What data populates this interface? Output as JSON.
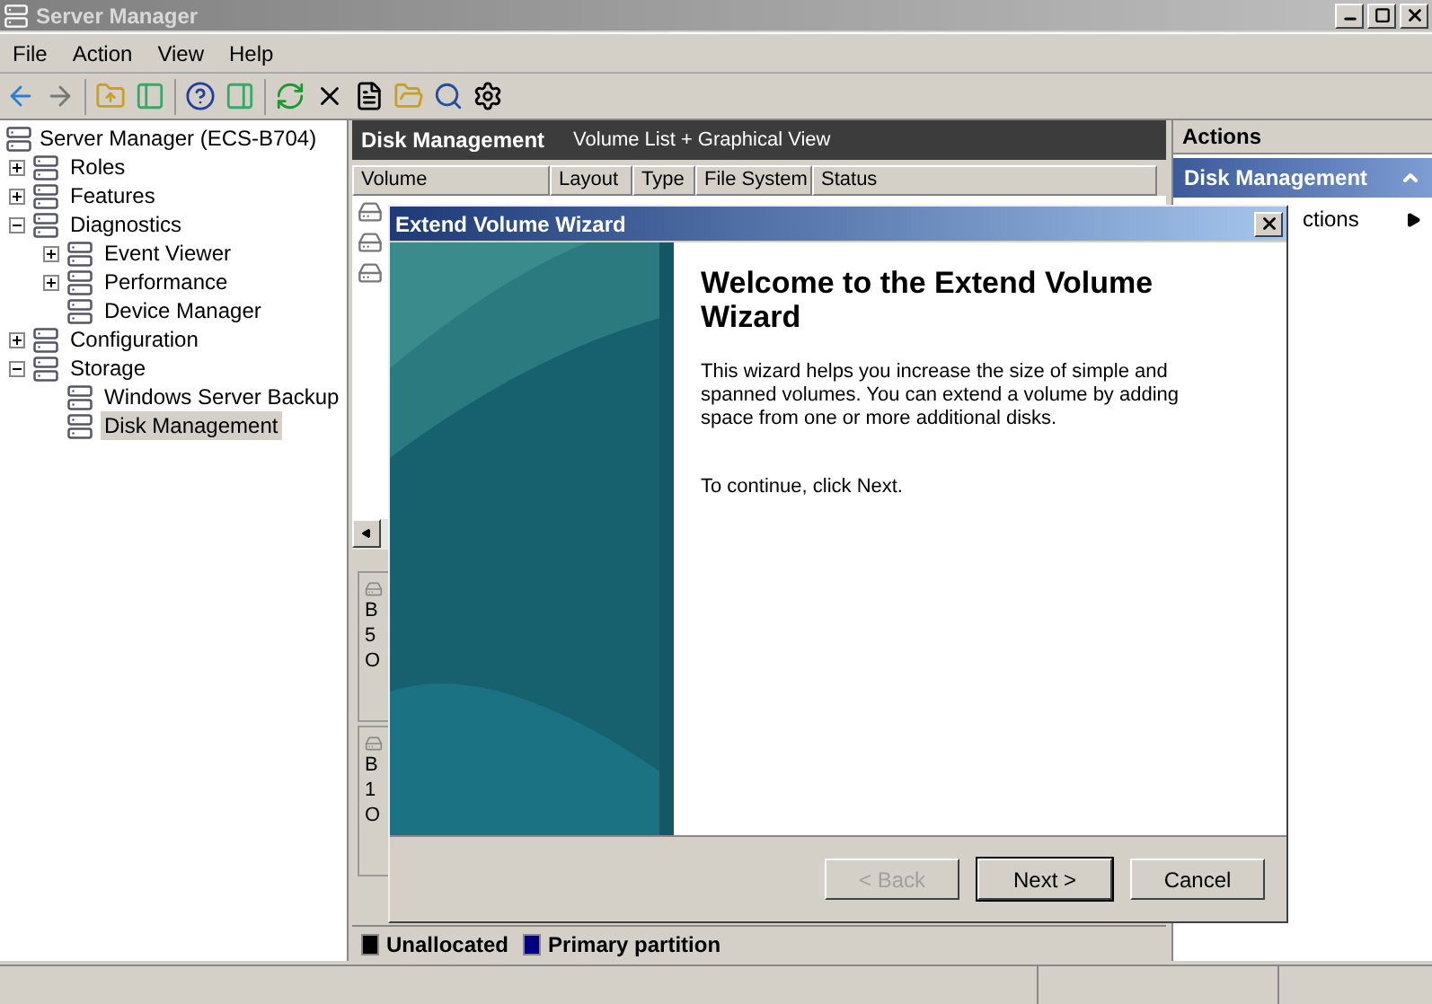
{
  "window": {
    "title": "Server Manager"
  },
  "menu": [
    "File",
    "Action",
    "View",
    "Help"
  ],
  "tree": {
    "label": "Server Manager (ECS-B704)",
    "selected": false,
    "children": [
      {
        "label": "Roles",
        "expanded": false,
        "selected": false
      },
      {
        "label": "Features",
        "expanded": false,
        "selected": false
      },
      {
        "label": "Diagnostics",
        "expanded": true,
        "selected": false,
        "children": [
          {
            "label": "Event Viewer",
            "expanded": false,
            "selected": false
          },
          {
            "label": "Performance",
            "expanded": false,
            "selected": false
          },
          {
            "label": "Device Manager",
            "selected": false
          }
        ]
      },
      {
        "label": "Configuration",
        "expanded": false,
        "selected": false
      },
      {
        "label": "Storage",
        "expanded": true,
        "selected": false,
        "children": [
          {
            "label": "Windows Server Backup",
            "selected": false
          },
          {
            "label": "Disk Management",
            "selected": true
          }
        ]
      }
    ]
  },
  "center": {
    "title": "Disk Management",
    "subtitle": "Volume List + Graphical View",
    "columns": [
      "Volume",
      "Layout",
      "Type",
      "File System",
      "Status"
    ],
    "disks": [
      [
        "B",
        "5",
        "O"
      ],
      [
        "B",
        "1",
        "O"
      ]
    ],
    "legend": [
      {
        "label": "Unallocated",
        "color": "#000000"
      },
      {
        "label": "Primary partition",
        "color": "#000080"
      }
    ]
  },
  "actions": {
    "title": "Actions",
    "section": "Disk Management",
    "item": "ctions"
  },
  "wizard": {
    "title": "Extend Volume Wizard",
    "heading": "Welcome to the Extend Volume Wizard",
    "body": "This wizard helps you increase the size of simple and spanned volumes. You can extend a volume  by adding space from one or more additional disks.",
    "hint": "To continue, click Next.",
    "buttons": [
      {
        "label": "< Back",
        "disabled": true
      },
      {
        "label": "Next >",
        "disabled": false
      },
      {
        "label": "Cancel",
        "disabled": false
      }
    ]
  }
}
